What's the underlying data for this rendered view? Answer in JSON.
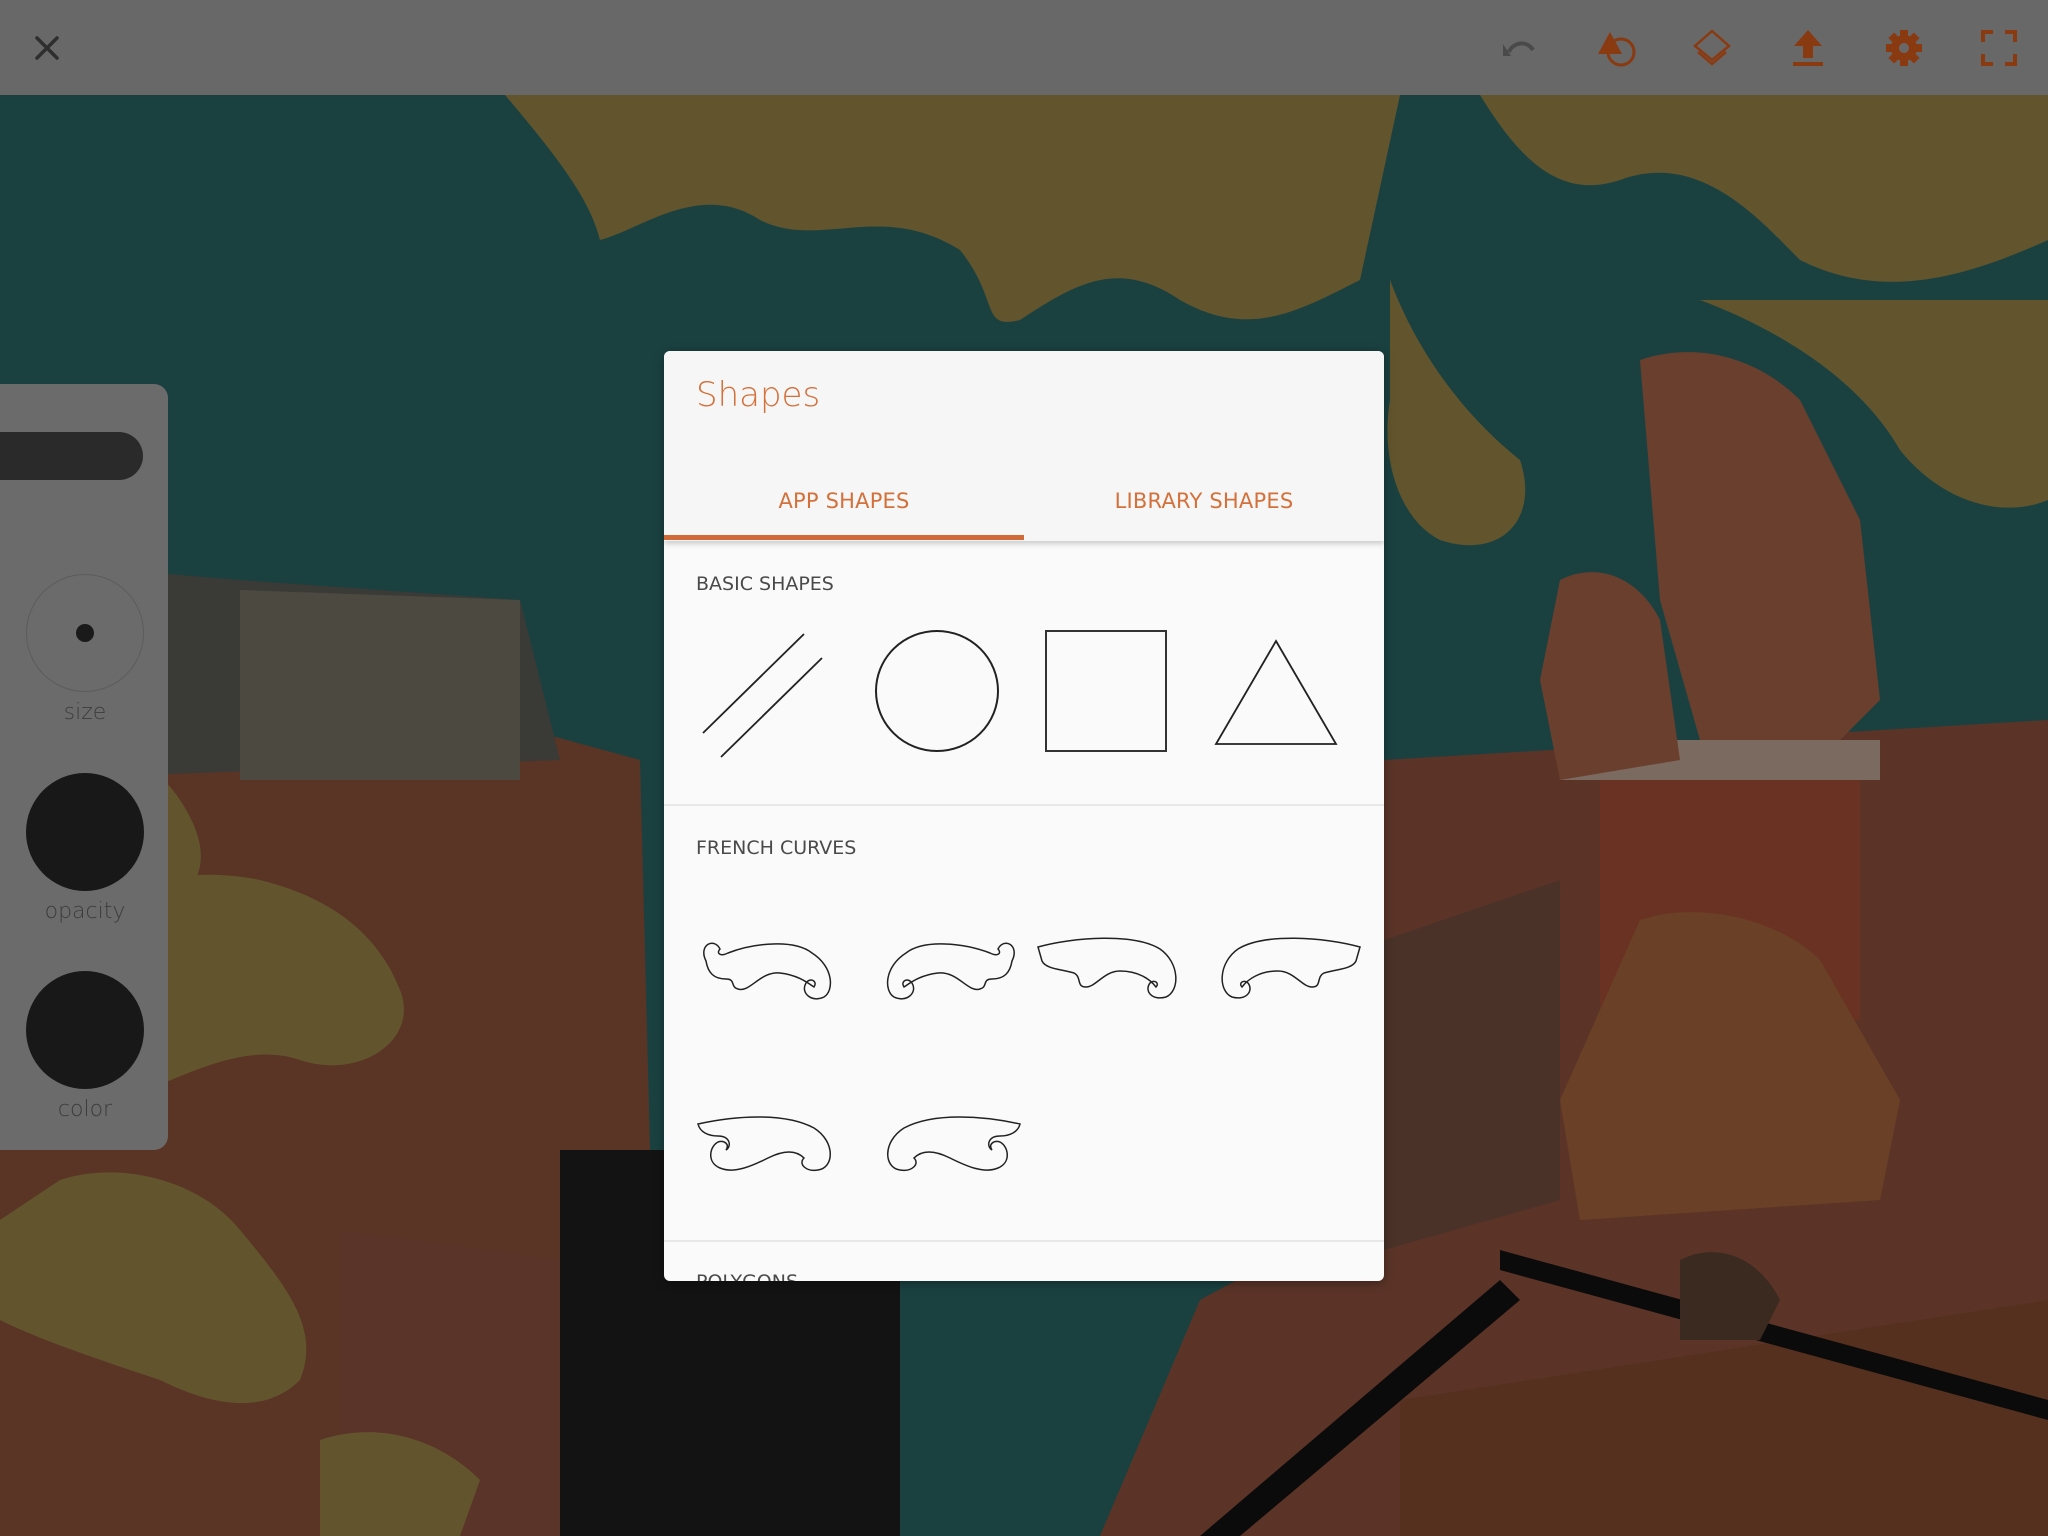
{
  "toolbar": {
    "close_icon": "close-icon",
    "icons": [
      {
        "name": "undo-icon",
        "color": "#4a4a4a",
        "enabled": false
      },
      {
        "name": "shapes-icon",
        "color": "#8a3a10"
      },
      {
        "name": "layers-icon",
        "color": "#8a3a10"
      },
      {
        "name": "upload-icon",
        "color": "#8a3a10"
      },
      {
        "name": "settings-icon",
        "color": "#8a3a10"
      },
      {
        "name": "fullscreen-icon",
        "color": "#8a3a10"
      }
    ]
  },
  "brush_panel": {
    "size_label": "size",
    "opacity_label": "opacity",
    "color_label": "color",
    "current_color": "#181818"
  },
  "dialog": {
    "title": "Shapes",
    "tabs": [
      {
        "label": "APP SHAPES",
        "active": true
      },
      {
        "label": "LIBRARY SHAPES",
        "active": false
      }
    ],
    "sections": [
      {
        "label": "BASIC SHAPES",
        "items": [
          "parallel-lines",
          "circle",
          "square",
          "triangle"
        ]
      },
      {
        "label": "FRENCH CURVES",
        "items": [
          "french-curve-1",
          "french-curve-2",
          "french-curve-3",
          "french-curve-4",
          "french-curve-5",
          "french-curve-6"
        ]
      },
      {
        "label": "POLYGONS",
        "items": []
      }
    ]
  },
  "colors": {
    "accent": "#d4703a",
    "toolbar_icon": "#8a3a10",
    "topbar_bg": "#686868"
  }
}
